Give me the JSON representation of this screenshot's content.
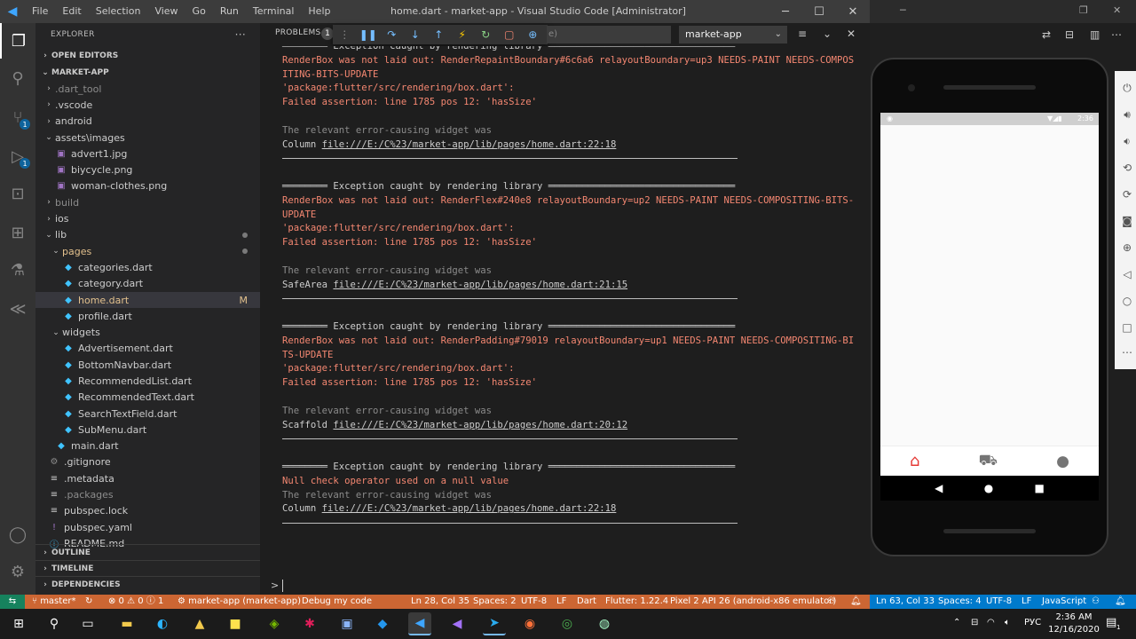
{
  "titlebar": {
    "menus": [
      "File",
      "Edit",
      "Selection",
      "View",
      "Go",
      "Run",
      "Terminal",
      "Help"
    ],
    "window_title": "home.dart - market-app - Visual Studio Code [Administrator]"
  },
  "sidebar": {
    "header": "EXPLORER",
    "more": "···",
    "open_editors": "OPEN EDITORS",
    "project": "MARKET-APP",
    "tree": [
      {
        "label": ".dart_tool",
        "depth": 1,
        "kind": "folder",
        "open": false,
        "dim": true
      },
      {
        "label": ".vscode",
        "depth": 1,
        "kind": "folder",
        "open": false
      },
      {
        "label": "android",
        "depth": 1,
        "kind": "folder",
        "open": false
      },
      {
        "label": "assets\\images",
        "depth": 1,
        "kind": "folder",
        "open": true
      },
      {
        "label": "advert1.jpg",
        "depth": 2,
        "kind": "image"
      },
      {
        "label": "biycycle.png",
        "depth": 2,
        "kind": "image"
      },
      {
        "label": "woman-clothes.png",
        "depth": 2,
        "kind": "image"
      },
      {
        "label": "build",
        "depth": 1,
        "kind": "folder",
        "open": false,
        "dim": true
      },
      {
        "label": "ios",
        "depth": 1,
        "kind": "folder",
        "open": false
      },
      {
        "label": "lib",
        "depth": 1,
        "kind": "folder",
        "open": true,
        "dot": true
      },
      {
        "label": "pages",
        "depth": 2,
        "kind": "folder",
        "open": true,
        "dot": true,
        "accent": true
      },
      {
        "label": "categories.dart",
        "depth": 3,
        "kind": "dart"
      },
      {
        "label": "category.dart",
        "depth": 3,
        "kind": "dart"
      },
      {
        "label": "home.dart",
        "depth": 3,
        "kind": "dart",
        "selected": true,
        "badge": "M",
        "accent": true
      },
      {
        "label": "profile.dart",
        "depth": 3,
        "kind": "dart"
      },
      {
        "label": "widgets",
        "depth": 2,
        "kind": "folder",
        "open": true
      },
      {
        "label": "Advertisement.dart",
        "depth": 3,
        "kind": "dart"
      },
      {
        "label": "BottomNavbar.dart",
        "depth": 3,
        "kind": "dart"
      },
      {
        "label": "RecommendedList.dart",
        "depth": 3,
        "kind": "dart"
      },
      {
        "label": "RecommendedText.dart",
        "depth": 3,
        "kind": "dart"
      },
      {
        "label": "SearchTextField.dart",
        "depth": 3,
        "kind": "dart"
      },
      {
        "label": "SubMenu.dart",
        "depth": 3,
        "kind": "dart"
      },
      {
        "label": "main.dart",
        "depth": 2,
        "kind": "dart"
      },
      {
        "label": ".gitignore",
        "depth": 1,
        "kind": "gear"
      },
      {
        "label": ".metadata",
        "depth": 1,
        "kind": "file"
      },
      {
        "label": ".packages",
        "depth": 1,
        "kind": "file",
        "dim": true
      },
      {
        "label": "pubspec.lock",
        "depth": 1,
        "kind": "file"
      },
      {
        "label": "pubspec.yaml",
        "depth": 1,
        "kind": "yaml"
      },
      {
        "label": "README.md",
        "depth": 1,
        "kind": "info"
      }
    ],
    "outline": "OUTLINE",
    "timeline": "TIMELINE",
    "dependencies": "DEPENDENCIES"
  },
  "panel": {
    "problems_label": "PROBLEMS",
    "problems_count": "1",
    "filter_text": "e)",
    "target": "market-app"
  },
  "console": {
    "blocks": [
      {
        "header": "════════ Exception caught by rendering library ═════════════════════════════════",
        "header_partial": true,
        "error_lines": [
          "RenderBox was not laid out: RenderRepaintBoundary#6c6a6 relayoutBoundary=up3 NEEDS-PAINT NEEDS-COMPOS",
          "ITING-BITS-UPDATE",
          "'package:flutter/src/rendering/box.dart':",
          "Failed assertion: line 1785 pos 12: 'hasSize'"
        ],
        "relevant": "The relevant error-causing widget was",
        "widget": "Column",
        "link": "file:///E:/C%23/market-app/lib/pages/home.dart:22:18"
      },
      {
        "header": "════════ Exception caught by rendering library ═════════════════════════════════",
        "error_lines": [
          "RenderBox was not laid out: RenderFlex#240e8 relayoutBoundary=up2 NEEDS-PAINT NEEDS-COMPOSITING-BITS-",
          "UPDATE",
          "'package:flutter/src/rendering/box.dart':",
          "Failed assertion: line 1785 pos 12: 'hasSize'"
        ],
        "relevant": "The relevant error-causing widget was",
        "widget": "SafeArea",
        "link": "file:///E:/C%23/market-app/lib/pages/home.dart:21:15"
      },
      {
        "header": "════════ Exception caught by rendering library ═════════════════════════════════",
        "error_lines": [
          "RenderBox was not laid out: RenderPadding#79019 relayoutBoundary=up1 NEEDS-PAINT NEEDS-COMPOSITING-BI",
          "TS-UPDATE",
          "'package:flutter/src/rendering/box.dart':",
          "Failed assertion: line 1785 pos 12: 'hasSize'"
        ],
        "relevant": "The relevant error-causing widget was",
        "widget": "Scaffold",
        "link": "file:///E:/C%23/market-app/lib/pages/home.dart:20:12"
      },
      {
        "header": "════════ Exception caught by rendering library ═════════════════════════════════",
        "error_lines": [
          "Null check operator used on a null value"
        ],
        "relevant": "The relevant error-causing widget was",
        "widget": "Column",
        "link": "file:///E:/C%23/market-app/lib/pages/home.dart:22:18"
      }
    ],
    "prompt": ">"
  },
  "statusbar": {
    "branch": "master*",
    "problems": "⊗ 0 ⚠ 0 ⓘ 1",
    "launch": "market-app (market-app)",
    "debug": "Debug my code",
    "position": "Ln 28, Col 35",
    "spaces": "Spaces: 2",
    "encoding": "UTF-8",
    "eol": "LF",
    "language": "Dart",
    "flutter": "Flutter: 1.22.4",
    "device": "Pixel 2 API 26 (android-x86 emulator)",
    "right_position": "Ln 63, Col 33",
    "right_spaces": "Spaces: 4",
    "right_encoding": "UTF-8",
    "right_eol": "LF",
    "right_language": "JavaScript"
  },
  "emulator": {
    "time": "2:36",
    "nav_icons": [
      "home-icon",
      "cart-icon",
      "person-icon"
    ]
  },
  "taskbar": {
    "lang": "РУС",
    "time": "2:36 AM",
    "date": "12/16/2020",
    "notify": "1"
  },
  "colors": {
    "statusbar": "#cc6633",
    "error_text": "#f48771",
    "accent_home": "#e53935"
  }
}
